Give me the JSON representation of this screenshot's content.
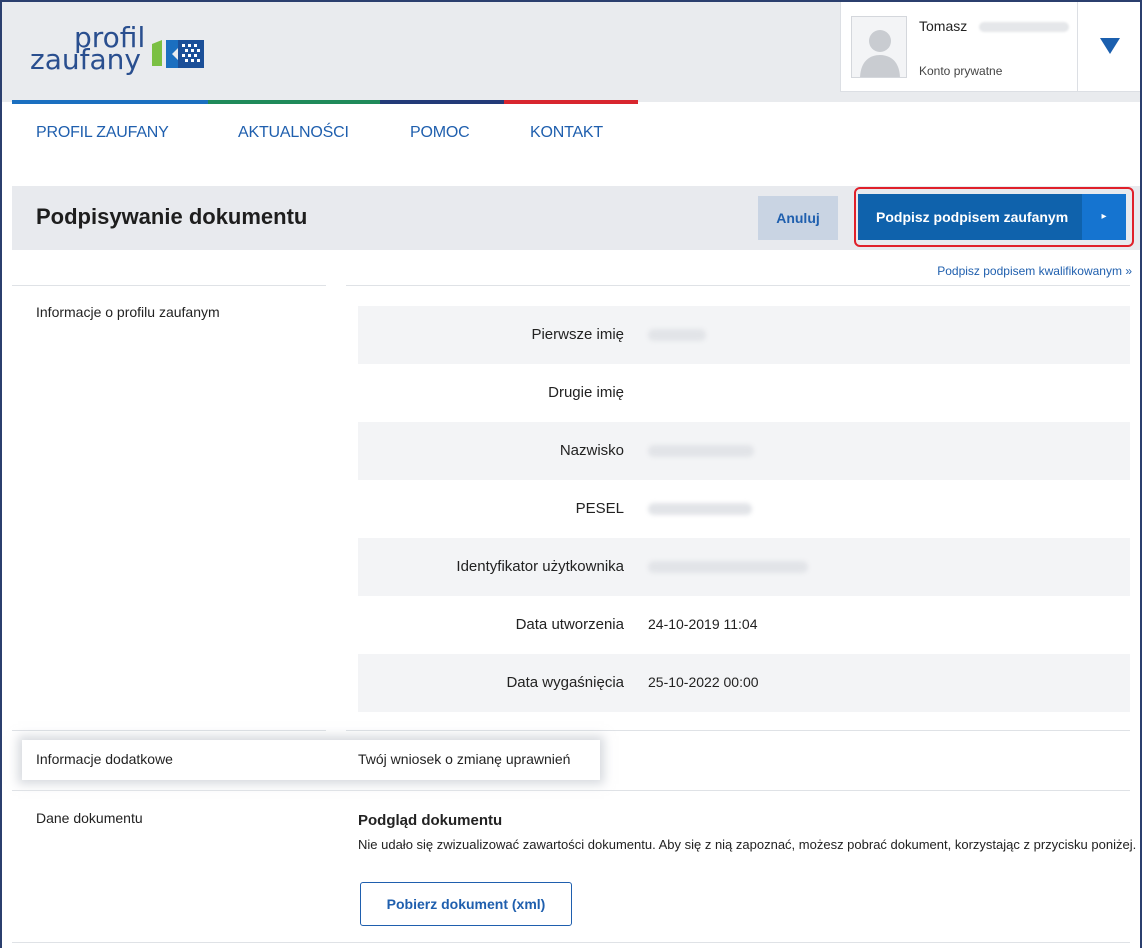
{
  "logo": {
    "line1": "profil",
    "line2": "zaufany"
  },
  "user": {
    "first_name": "Tomasz",
    "account_type": "Konto prywatne"
  },
  "nav": [
    "PROFIL ZAUFANY",
    "AKTUALNOŚCI",
    "POMOC",
    "KONTAKT"
  ],
  "page": {
    "title": "Podpisywanie dokumentu",
    "cancel_label": "Anuluj",
    "sign_label": "Podpisz podpisem zaufanym",
    "sign_arrow": "▸",
    "qualified_link": "Podpisz podpisem kwalifikowanym »"
  },
  "profile_info": {
    "section_label": "Informacje o profilu zaufanym",
    "rows": [
      {
        "key": "Pierwsze imię",
        "value": ""
      },
      {
        "key": "Drugie imię",
        "value": ""
      },
      {
        "key": "Nazwisko",
        "value": ""
      },
      {
        "key": "PESEL",
        "value": ""
      },
      {
        "key": "Identyfikator użytkownika",
        "value": ""
      },
      {
        "key": "Data utworzenia",
        "value": "24-10-2019 11:04"
      },
      {
        "key": "Data wygaśnięcia",
        "value": "25-10-2022 00:00"
      }
    ]
  },
  "extra": {
    "label": "Informacje dodatkowe",
    "value": "Twój wniosek o zmianę uprawnień"
  },
  "document": {
    "section_label": "Dane dokumentu",
    "preview_title": "Podgląd dokumentu",
    "preview_text": "Nie udało się zwizualizować zawartości dokumentu. Aby się z nią zapoznać, możesz pobrać dokument, korzystając z przycisku poniżej.",
    "download_label": "Pobierz dokument (xml)"
  },
  "colors": {
    "brand_blue": "#0f62ac",
    "link_blue": "#1f5fae",
    "highlight_red": "#e0202a",
    "bar_blue": "#1b6fc0",
    "bar_green": "#1f8a5a",
    "bar_navy": "#233a78",
    "bar_red": "#d8262e"
  }
}
